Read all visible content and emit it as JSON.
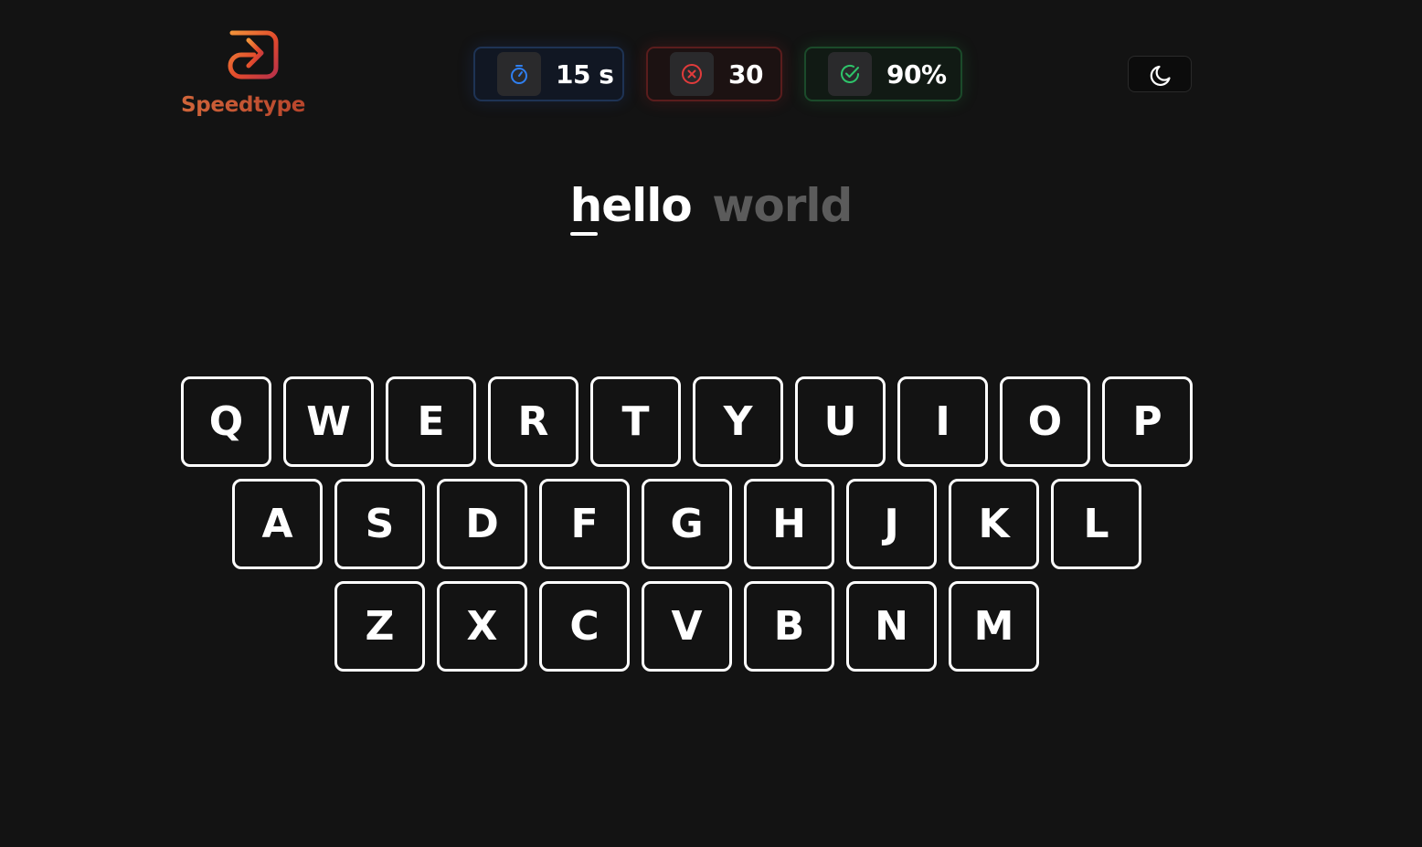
{
  "brand": {
    "name": "Speedtype",
    "logo_icon": "speed-arrow-logo-icon",
    "colors": [
      "#f2923a",
      "#e24a2c",
      "#b8314a"
    ]
  },
  "stats": {
    "time": {
      "value": "15 s",
      "icon": "stopwatch-icon",
      "color": "#2f7ff0"
    },
    "errors": {
      "value": "30",
      "icon": "x-circle-icon",
      "color": "#e03b3b"
    },
    "accuracy": {
      "value": "90%",
      "icon": "check-circle-icon",
      "color": "#2ec46a"
    }
  },
  "theme_toggle": {
    "icon": "moon-icon",
    "mode": "dark"
  },
  "prompt": {
    "current_word": "hello",
    "next_word": "world"
  },
  "keyboard": {
    "rows": [
      [
        "Q",
        "W",
        "E",
        "R",
        "T",
        "Y",
        "U",
        "I",
        "O",
        "P"
      ],
      [
        "A",
        "S",
        "D",
        "F",
        "G",
        "H",
        "J",
        "K",
        "L"
      ],
      [
        "Z",
        "X",
        "C",
        "V",
        "B",
        "N",
        "M"
      ]
    ]
  }
}
